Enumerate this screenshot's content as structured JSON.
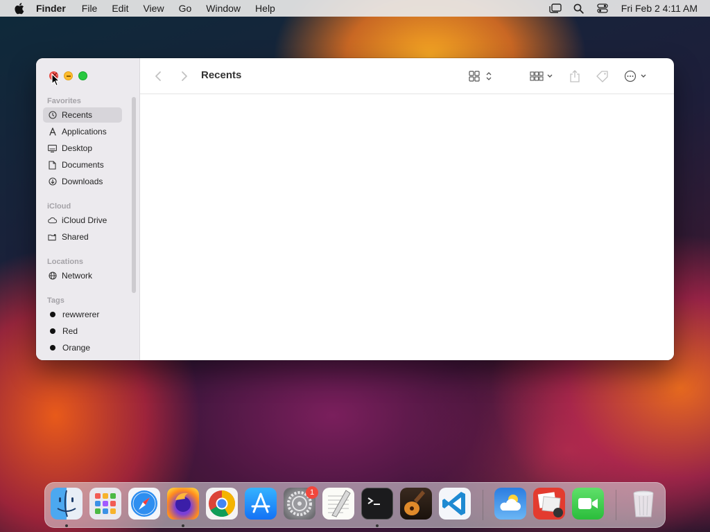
{
  "menubar": {
    "app_name": "Finder",
    "menus": [
      "File",
      "Edit",
      "View",
      "Go",
      "Window",
      "Help"
    ],
    "clock": "Fri Feb 2  4:11 AM"
  },
  "window": {
    "title": "Recents"
  },
  "sidebar": {
    "favorites_title": "Favorites",
    "favorites": [
      {
        "label": "Recents",
        "icon": "clock-icon",
        "selected": true
      },
      {
        "label": "Applications",
        "icon": "applications-icon"
      },
      {
        "label": "Desktop",
        "icon": "desktop-icon"
      },
      {
        "label": "Documents",
        "icon": "document-icon"
      },
      {
        "label": "Downloads",
        "icon": "download-icon"
      }
    ],
    "icloud_title": "iCloud",
    "icloud": [
      {
        "label": "iCloud Drive",
        "icon": "cloud-icon"
      },
      {
        "label": "Shared",
        "icon": "shared-folder-icon"
      }
    ],
    "locations_title": "Locations",
    "locations": [
      {
        "label": "Network",
        "icon": "globe-icon"
      }
    ],
    "tags_title": "Tags",
    "tags": [
      {
        "label": "rewwrerer"
      },
      {
        "label": "Red"
      },
      {
        "label": "Orange"
      }
    ]
  },
  "dock": {
    "apps": [
      {
        "name": "finder-icon"
      },
      {
        "name": "launchpad-icon"
      },
      {
        "name": "safari-icon"
      },
      {
        "name": "firefox-icon"
      },
      {
        "name": "chrome-icon"
      },
      {
        "name": "app-store-icon"
      },
      {
        "name": "system-settings-icon",
        "badge": "1"
      },
      {
        "name": "textedit-icon"
      },
      {
        "name": "terminal-icon"
      },
      {
        "name": "garageband-icon"
      },
      {
        "name": "vscode-icon"
      },
      {
        "name": "weather-icon"
      },
      {
        "name": "photo-booth-icon"
      },
      {
        "name": "facetime-icon"
      },
      {
        "name": "trash-icon"
      }
    ]
  },
  "colors": {
    "close": "#fd5f57",
    "minimize": "#febc2e",
    "maximize": "#28c840",
    "selected_row": "#d7d5da"
  }
}
